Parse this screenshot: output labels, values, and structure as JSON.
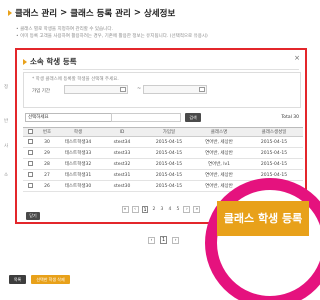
{
  "breadcrumb": [
    "클래스 관리",
    ">",
    "클래스 등록 관리",
    ">",
    "상세정보"
  ],
  "page_notes": [
    "• 클래스 별로 학생을 지정하여 관리할 수 있습니다.",
    "• 이미 등록 고객을 사용하여 활용하려는 경우, 기존에 활용한 정보는 유지됩니다. (선택적으로 유용시)"
  ],
  "modal": {
    "title": "소속 학생 등록",
    "close_glyph": "×",
    "hint": "* 학생 클래스에 등록할 학생을 선택해 주세요.",
    "period_label": "가입 기간",
    "period_dash": "~",
    "select_value": "선택하세요",
    "select_arrow": "▼",
    "search_label": "검색",
    "total": "Total 30",
    "columns": [
      "",
      "번호",
      "학생",
      "ID",
      "가입일",
      "클래스명",
      "클래스생성일"
    ],
    "rows": [
      {
        "no": "30",
        "name": "테스트학생34",
        "id": "stest34",
        "joined": "2015-04-15",
        "class": "연어반, 세상반",
        "created": "2015-04-15"
      },
      {
        "no": "29",
        "name": "테스트학생33",
        "id": "stest33",
        "joined": "2015-04-15",
        "class": "연어반, 세상반",
        "created": "2015-04-15"
      },
      {
        "no": "28",
        "name": "테스트학생32",
        "id": "stest32",
        "joined": "2015-04-15",
        "class": "연어반, lv1",
        "created": "2015-04-15"
      },
      {
        "no": "27",
        "name": "테스트학생31",
        "id": "stest31",
        "joined": "2015-04-15",
        "class": "연어반, 세상반",
        "created": "2015-04-15"
      },
      {
        "no": "26",
        "name": "테스트학생30",
        "id": "stest30",
        "joined": "2015-04-15",
        "class": "연어반, 세상반",
        "created": "2015-04-15"
      }
    ],
    "pager": {
      "first": "«",
      "prev": "‹",
      "pages": [
        "1",
        "2",
        "3",
        "4",
        "5"
      ],
      "current": "1",
      "next": "›",
      "last": "»"
    },
    "close_label": "닫기"
  },
  "bg_left_labels": [
    "정",
    "반",
    "사",
    "소"
  ],
  "bg_pager": {
    "prev": "‹",
    "current": "1",
    "next": "›"
  },
  "buttons": {
    "list": "목록",
    "delete": "선택한 학생 삭제",
    "register": "클래스 학생 등록"
  },
  "colors": {
    "accent": "#e8a11a",
    "highlight_box": "#e3262b",
    "highlight_ring": "#e5127e"
  }
}
